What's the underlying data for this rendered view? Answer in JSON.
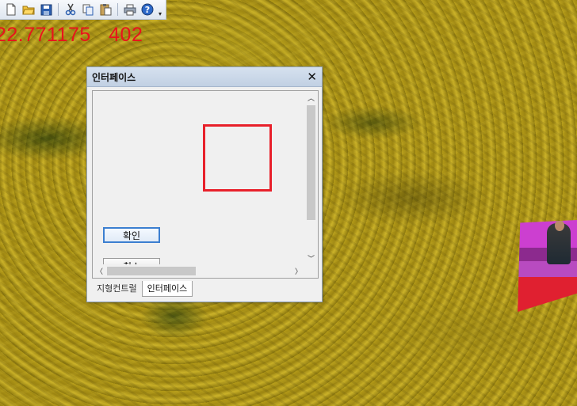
{
  "toolbar": {
    "buttons": [
      "new-icon",
      "open-icon",
      "save-icon",
      "cut-icon",
      "copy-icon",
      "paste-icon",
      "print-icon",
      "help-icon"
    ]
  },
  "overlay": {
    "coord_text": "22.771175   402"
  },
  "dialog": {
    "title": "인터페이스",
    "close_glyph": "✕",
    "ok_label": "확인",
    "cancel_label": "취소",
    "tabs": [
      {
        "label": "지형컨트럴",
        "active": false
      },
      {
        "label": "인터페이스",
        "active": true
      }
    ]
  },
  "colors": {
    "overlay_text": "#e8141c",
    "selection_box": "#e8202a",
    "titlebar": "#c1d0e3"
  }
}
